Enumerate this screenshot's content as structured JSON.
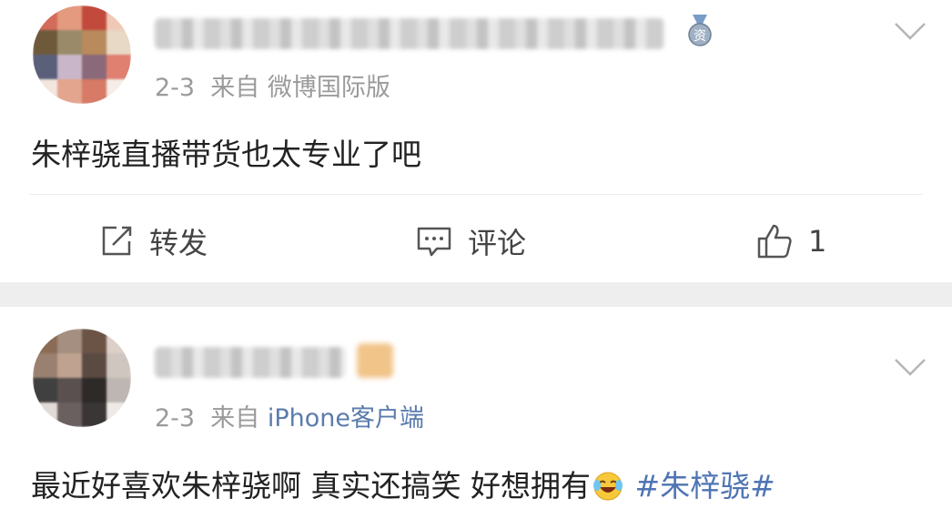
{
  "posts": [
    {
      "meta": {
        "date": "2-3",
        "via": "来自",
        "source": "微博国际版"
      },
      "content": "朱梓骁直播带货也太专业了吧",
      "actions": {
        "repost": "转发",
        "comment": "评论",
        "like_count": "1"
      },
      "icons": {
        "badge": "medal-badge-icon",
        "menu": "chevron-down-icon",
        "repost": "repost-icon",
        "comment": "comment-icon",
        "like": "thumbs-up-icon"
      }
    },
    {
      "meta": {
        "date": "2-3",
        "via": "来自",
        "source": "iPhone客户端"
      },
      "content": "最近好喜欢朱梓骁啊 真实还搞笑 好想拥有",
      "hashtag": "#朱梓骁#",
      "icons": {
        "menu": "chevron-down-icon",
        "emoji": "laughing-tears-emoji-icon"
      }
    }
  ],
  "colors": {
    "link": "#4f74b3",
    "meta": "#9a9a9a",
    "separator": "#eeeeee"
  }
}
